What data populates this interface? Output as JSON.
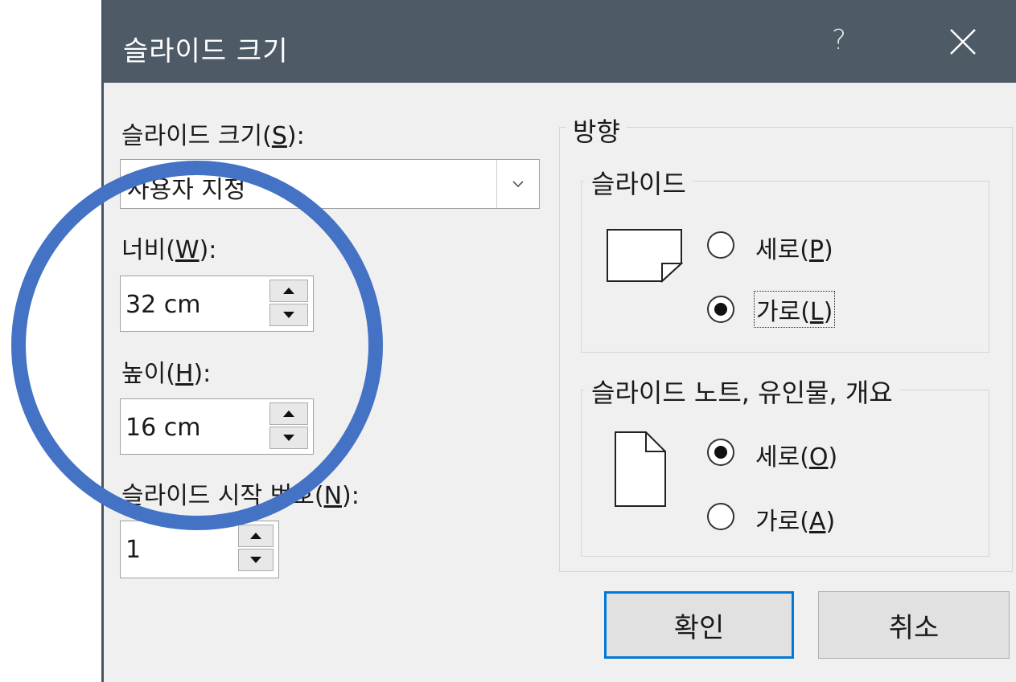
{
  "dialog": {
    "title": "슬라이드 크기",
    "help_label": "?"
  },
  "left": {
    "size_label": "슬라이드 크기(",
    "size_key": "S",
    "size_suffix": "):",
    "size_value": "사용자 지정",
    "width_label": "너비(",
    "width_key": "W",
    "width_suffix": "):",
    "width_value": "32 cm",
    "height_label": "높이(",
    "height_key": "H",
    "height_suffix": "):",
    "height_value": "16 cm",
    "start_label": "슬라이드 시작 번호(",
    "start_key": "N",
    "start_suffix": "):",
    "start_value": "1"
  },
  "orientation": {
    "title": "방향",
    "slides": {
      "title": "슬라이드",
      "portrait_label": "세로(",
      "portrait_key": "P",
      "landscape_label": "가로(",
      "landscape_key": "L",
      "selected": "landscape"
    },
    "notes": {
      "title": "슬라이드 노트, 유인물, 개요",
      "portrait_label": "세로(",
      "portrait_key": "O",
      "landscape_label": "가로(",
      "landscape_key": "A",
      "selected": "portrait"
    },
    "close_paren": ")"
  },
  "buttons": {
    "ok": "확인",
    "cancel": "취소"
  },
  "colors": {
    "titlebar": "#4f5a67",
    "dialog_bg": "#f0f0f0",
    "accent": "#0078d7",
    "annotation": "#4472c4"
  }
}
